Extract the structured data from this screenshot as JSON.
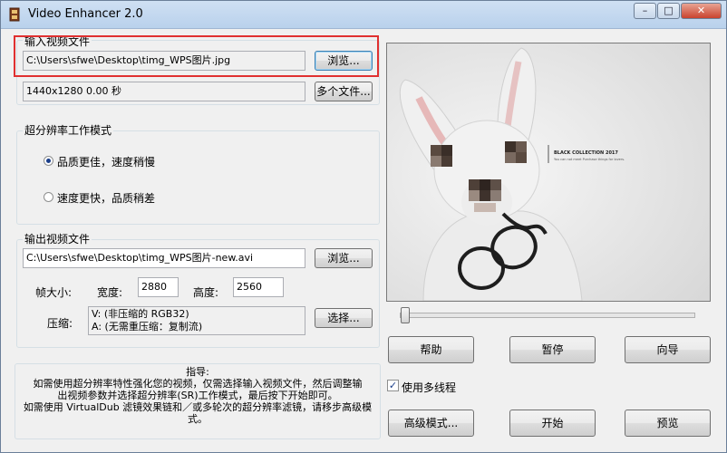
{
  "window": {
    "title": "Video Enhancer 2.0"
  },
  "input": {
    "group_label": "输入视频文件",
    "path": "C:\\Users\\sfwe\\Desktop\\timg_WPS图片.jpg",
    "browse_label": "浏览...",
    "info": "1440x1280 0.00 秒",
    "multi_label": "多个文件..."
  },
  "mode": {
    "group_label": "超分辨率工作模式",
    "options": [
      "品质更佳，速度稍慢",
      "速度更快，品质稍差"
    ],
    "selected": 0
  },
  "output": {
    "group_label": "输出视频文件",
    "path": "C:\\Users\\sfwe\\Desktop\\timg_WPS图片-new.avi",
    "browse_label": "浏览...",
    "frame_size_label": "帧大小:",
    "width_label": "宽度:",
    "width_value": "2880",
    "height_label": "高度:",
    "height_value": "2560",
    "compress_label": "压缩:",
    "compress_line1": "V: (非压缩的 RGB32)",
    "compress_line2": "A: (无需重压缩：复制流)",
    "choose_label": "选择..."
  },
  "guide": {
    "title": "指导:",
    "line1": "如需使用超分辨率特性强化您的视频，仅需选择输入视频文件，然后调整输",
    "line2": "出视频参数并选择超分辨率(SR)工作模式，最后按下开始即可。",
    "line3": "如需使用 VirtualDub 滤镜效果链和／或多轮次的超分辨率滤镜，请移步高级模",
    "line4": "式。"
  },
  "preview": {
    "image_text_title": "BLACK COLLECTION 2017",
    "image_text_sub": "You can not meet Purchase things for lovers."
  },
  "buttons": {
    "help": "帮助",
    "pause": "暂停",
    "wizard": "向导",
    "advanced": "高级模式...",
    "start": "开始",
    "preview": "预览"
  },
  "multithread": {
    "label": "使用多线程",
    "checked": true
  },
  "icons": {
    "app": "film-icon",
    "minimize": "minimize-icon",
    "maximize": "maximize-icon",
    "close": "close-icon"
  }
}
